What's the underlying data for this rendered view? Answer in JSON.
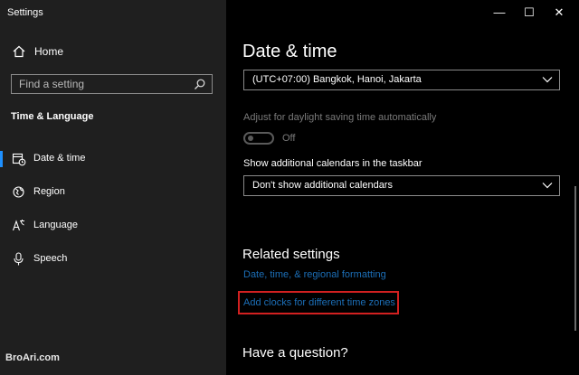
{
  "window": {
    "title": "Settings",
    "controls": {
      "minimize": "—",
      "maximize": "☐",
      "close": "✕"
    }
  },
  "sidebar": {
    "home_label": "Home",
    "search_placeholder": "Find a setting",
    "section_title": "Time & Language",
    "items": [
      {
        "label": "Date & time",
        "icon": "calendar-clock-icon",
        "active": true
      },
      {
        "label": "Region",
        "icon": "globe-icon",
        "active": false
      },
      {
        "label": "Language",
        "icon": "language-icon",
        "active": false
      },
      {
        "label": "Speech",
        "icon": "microphone-icon",
        "active": false
      }
    ]
  },
  "main": {
    "title": "Date & time",
    "timezone_value": "(UTC+07:00) Bangkok, Hanoi, Jakarta",
    "dst_label": "Adjust for daylight saving time automatically",
    "dst_state": "Off",
    "calendars_label": "Show additional calendars in the taskbar",
    "calendars_value": "Don't show additional calendars",
    "related_title": "Related settings",
    "links": [
      "Date, time, & regional formatting",
      "Add clocks for different time zones"
    ],
    "question_title": "Have a question?"
  },
  "watermark": "BroAri.com",
  "colors": {
    "accent": "#1e90ff",
    "link": "#1c6fb8",
    "highlight": "#d22020"
  }
}
